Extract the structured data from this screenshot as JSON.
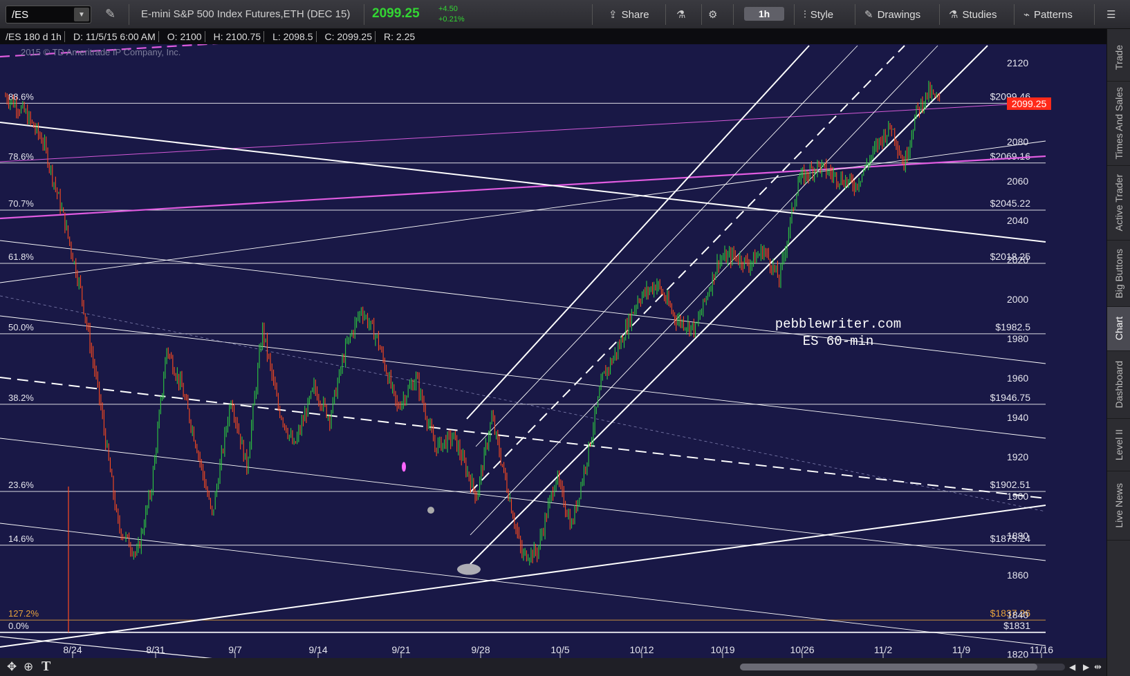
{
  "toolbar": {
    "symbol": "/ES",
    "description": "E-mini S&P 500 Index Futures,ETH (DEC 15)",
    "last_price": "2099.25",
    "net_change": "+4.50",
    "pct_change": "+0.21%",
    "share_label": "Share",
    "timeframe_label": "1h",
    "style_label": "Style",
    "drawings_label": "Drawings",
    "studies_label": "Studies",
    "patterns_label": "Patterns",
    "accent_green": "#33d633"
  },
  "chart_header": {
    "descriptor": "/ES 180 d 1h",
    "date": "D: 11/5/15 6:00 AM",
    "open": "O: 2100",
    "high": "H: 2100.75",
    "low": "L: 2098.5",
    "close": "C: 2099.25",
    "range": "R: 2.25"
  },
  "copyright": "2015 © TD Ameritrade IP Company, Inc.",
  "watermark": [
    "pebblewriter.com",
    "ES 60-min"
  ],
  "current_price_tag": "2099.25",
  "right_rail": {
    "tabs": [
      "Trade",
      "Times And Sales",
      "Active Trader",
      "Big Buttons",
      "Chart",
      "Dashboard",
      "Level II",
      "Live News"
    ],
    "active": "Chart"
  },
  "chart_data": {
    "type": "candlestick",
    "title": "",
    "xlabel": "",
    "ylabel": "",
    "ylim": [
      1818,
      2128
    ],
    "y_ticks": [
      1820,
      1840,
      1860,
      1880,
      1900,
      1920,
      1940,
      1960,
      1980,
      2000,
      2020,
      2040,
      2060,
      2080,
      2100,
      2120
    ],
    "x_ticks": [
      "8/24",
      "8/31",
      "9/7",
      "9/14",
      "9/21",
      "9/28",
      "10/5",
      "10/12",
      "10/19",
      "10/26",
      "11/2",
      "11/9",
      "11/16"
    ],
    "grid": false,
    "up_color": "#2ecc40",
    "down_color": "#ff4b1f",
    "fib_levels": [
      {
        "pct": "88.6%",
        "price": "$2099.46",
        "value": 2099.46
      },
      {
        "pct": "78.6%",
        "price": "$2069.16",
        "value": 2069.16
      },
      {
        "pct": "70.7%",
        "price": "$2045.22",
        "value": 2045.22
      },
      {
        "pct": "61.8%",
        "price": "$2018.25",
        "value": 2018.25
      },
      {
        "pct": "50.0%",
        "price": "$1982.5",
        "value": 1982.5
      },
      {
        "pct": "38.2%",
        "price": "$1946.75",
        "value": 1946.75
      },
      {
        "pct": "23.6%",
        "price": "$1902.51",
        "value": 1902.51
      },
      {
        "pct": "14.6%",
        "price": "$1875.24",
        "value": 1875.24
      },
      {
        "pct": "127.2%",
        "price": "$1837.26",
        "value": 1837.26,
        "color": "#e8a33c"
      },
      {
        "pct": "0.0%",
        "price": "$1831",
        "value": 1831
      }
    ],
    "price_path": [
      [
        "8/24",
        2103
      ],
      [
        "8/24",
        2095
      ],
      [
        "8/24",
        2080
      ],
      [
        "8/24",
        2045
      ],
      [
        "8/24",
        2005
      ],
      [
        "8/24",
        1950
      ],
      [
        "8/24",
        1885
      ],
      [
        "8/24",
        1870
      ],
      [
        "8/31",
        1905
      ],
      [
        "8/31",
        1975
      ],
      [
        "8/31",
        1955
      ],
      [
        "8/31",
        1925
      ],
      [
        "8/31",
        1890
      ],
      [
        "9/7",
        1950
      ],
      [
        "9/7",
        1915
      ],
      [
        "9/7",
        1985
      ],
      [
        "9/7",
        1945
      ],
      [
        "9/7",
        1925
      ],
      [
        "9/14",
        1955
      ],
      [
        "9/14",
        1940
      ],
      [
        "9/14",
        1975
      ],
      [
        "9/14",
        1995
      ],
      [
        "9/14",
        1980
      ],
      [
        "9/21",
        1945
      ],
      [
        "9/21",
        1960
      ],
      [
        "9/21",
        1925
      ],
      [
        "9/21",
        1930
      ],
      [
        "9/28",
        1900
      ],
      [
        "9/28",
        1940
      ],
      [
        "9/28",
        1905
      ],
      [
        "9/28",
        1870
      ],
      [
        "9/28",
        1872
      ],
      [
        "10/5",
        1910
      ],
      [
        "10/5",
        1885
      ],
      [
        "10/5",
        1920
      ],
      [
        "10/5",
        1960
      ],
      [
        "10/5",
        1975
      ],
      [
        "10/12",
        2000
      ],
      [
        "10/12",
        2008
      ],
      [
        "10/12",
        1990
      ],
      [
        "10/12",
        1985
      ],
      [
        "10/19",
        2020
      ],
      [
        "10/19",
        2022
      ],
      [
        "10/19",
        2018
      ],
      [
        "10/19",
        2025
      ],
      [
        "10/19",
        2010
      ],
      [
        "10/26",
        2060
      ],
      [
        "10/26",
        2068
      ],
      [
        "10/26",
        2062
      ],
      [
        "10/26",
        2058
      ],
      [
        "11/2",
        2080
      ],
      [
        "11/2",
        2088
      ],
      [
        "11/2",
        2068
      ],
      [
        "11/2",
        2095
      ],
      [
        "11/2",
        2105
      ],
      [
        "11/2",
        2099
      ]
    ]
  }
}
